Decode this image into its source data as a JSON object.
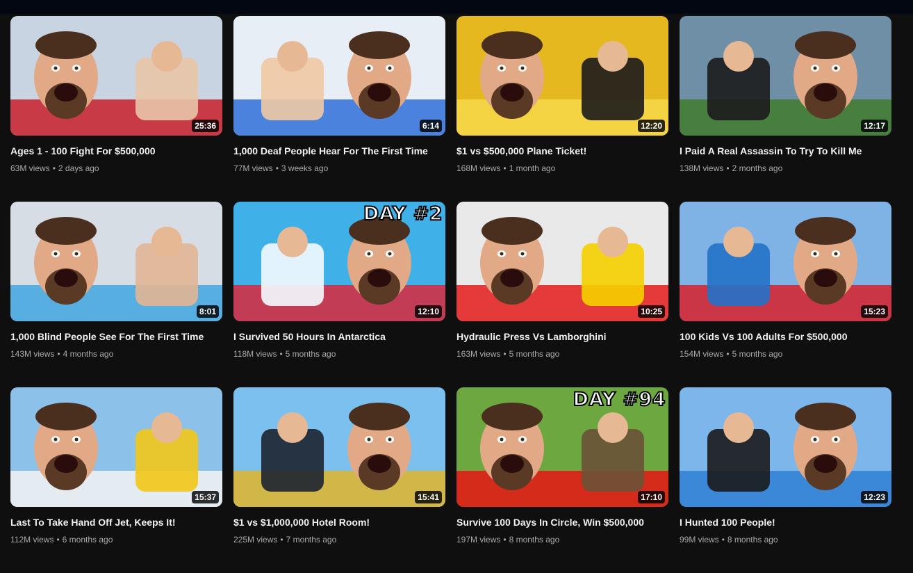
{
  "videos": [
    {
      "title": "Ages 1 - 100 Fight For $500,000",
      "views": "63M views",
      "age": "2 days ago",
      "duration": "25:36",
      "overlay": "",
      "palette": {
        "bg": "#c9d4e2",
        "a": "#c81e2a",
        "b": "#e8c5a8"
      }
    },
    {
      "title": "1,000 Deaf People Hear For The First Time",
      "views": "77M views",
      "age": "3 weeks ago",
      "duration": "6:14",
      "overlay": "",
      "palette": {
        "bg": "#e8eef6",
        "a": "#2e6fd8",
        "b": "#f0c9a4"
      }
    },
    {
      "title": "$1 vs $500,000 Plane Ticket!",
      "views": "168M views",
      "age": "1 month ago",
      "duration": "12:20",
      "overlay": "",
      "palette": {
        "bg": "#e6b820",
        "a": "#f7d84a",
        "b": "#1b1b1b"
      }
    },
    {
      "title": "I Paid A Real Assassin To Try To Kill Me",
      "views": "138M views",
      "age": "2 months ago",
      "duration": "12:17",
      "overlay": "",
      "palette": {
        "bg": "#6f8fa6",
        "a": "#3f7d2c",
        "b": "#1c1c1c"
      }
    },
    {
      "title": "1,000 Blind People See For The First Time",
      "views": "143M views",
      "age": "4 months ago",
      "duration": "8:01",
      "overlay": "",
      "palette": {
        "bg": "#d7dde4",
        "a": "#3fa6e0",
        "b": "#e2b594"
      }
    },
    {
      "title": "I Survived 50 Hours In Antarctica",
      "views": "118M views",
      "age": "5 months ago",
      "duration": "12:10",
      "overlay": "DAY #2",
      "palette": {
        "bg": "#3fb1e8",
        "a": "#d8283a",
        "b": "#f4fbff"
      }
    },
    {
      "title": "Hydraulic Press Vs Lamborghini",
      "views": "163M views",
      "age": "5 months ago",
      "duration": "10:25",
      "overlay": "",
      "palette": {
        "bg": "#e9e9e9",
        "a": "#e41b1b",
        "b": "#f5d000"
      }
    },
    {
      "title": "100 Kids Vs 100 Adults For $500,000",
      "views": "154M views",
      "age": "5 months ago",
      "duration": "15:23",
      "overlay": "",
      "palette": {
        "bg": "#7fb3e6",
        "a": "#d8202a",
        "b": "#2471c8"
      }
    },
    {
      "title": "Last To Take Hand Off Jet, Keeps It!",
      "views": "112M views",
      "age": "6 months ago",
      "duration": "15:37",
      "overlay": "",
      "palette": {
        "bg": "#8cc1ea",
        "a": "#f3f3f3",
        "b": "#f2c618"
      }
    },
    {
      "title": "$1 vs $1,000,000 Hotel Room!",
      "views": "225M views",
      "age": "7 months ago",
      "duration": "15:41",
      "overlay": "",
      "palette": {
        "bg": "#7cc0ef",
        "a": "#e0b52a",
        "b": "#1d2330"
      }
    },
    {
      "title": "Survive 100 Days In Circle, Win $500,000",
      "views": "197M views",
      "age": "8 months ago",
      "duration": "17:10",
      "overlay": "DAY #94",
      "palette": {
        "bg": "#6ca73f",
        "a": "#e81515",
        "b": "#6a5237"
      }
    },
    {
      "title": "I Hunted 100 People!",
      "views": "99M views",
      "age": "8 months ago",
      "duration": "12:23",
      "overlay": "",
      "palette": {
        "bg": "#7db6ea",
        "a": "#2f80d6",
        "b": "#1b1b1b"
      }
    }
  ]
}
